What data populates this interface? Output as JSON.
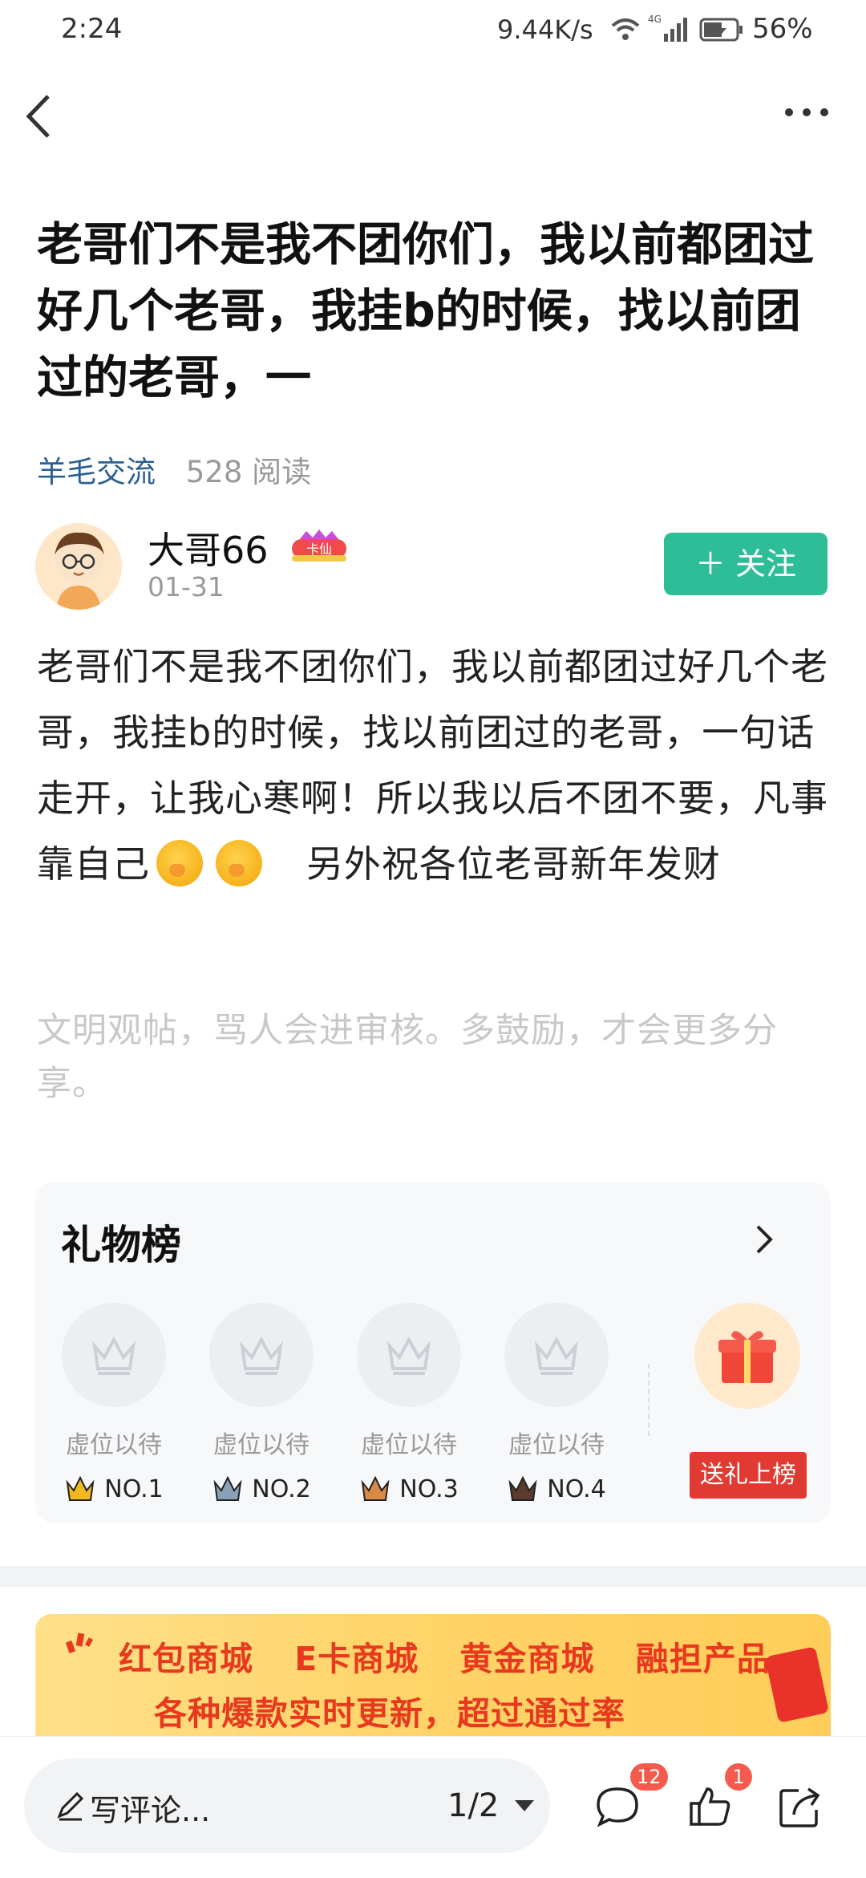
{
  "status_bar": {
    "time": "2:24",
    "net_speed": "9.44K/s",
    "battery": "56%",
    "network": "4G"
  },
  "post": {
    "title": "老哥们不是我不团你们，我以前都团过好几个老哥，我挂b的时候，找以前团过的老哥，一",
    "category": "羊毛交流",
    "reads": "528 阅读"
  },
  "author": {
    "name": "大哥66",
    "badge": "卡仙",
    "date": "01-31",
    "follow_label": "＋ 关注"
  },
  "content": {
    "part1": "老哥们不是我不团你们，我以前都团过好几个老哥，我挂b的时候，找以前团过的老哥，一句话走开，让我心寒啊！所以我以后不团不要，凡事靠自己",
    "part2": "另外祝各位老哥新年发财",
    "emoji_icon": "smirk-emoji-icon"
  },
  "notice": "文明观帖，骂人会进审核。多鼓励，才会更多分享。",
  "gift_board": {
    "title": "礼物榜",
    "slots": [
      {
        "label": "虚位以待",
        "rank": "NO.1",
        "crown_color": "#f3b921"
      },
      {
        "label": "虚位以待",
        "rank": "NO.2",
        "crown_color": "#8aa0b6"
      },
      {
        "label": "虚位以待",
        "rank": "NO.3",
        "crown_color": "#d98a45"
      },
      {
        "label": "虚位以待",
        "rank": "NO.4",
        "crown_color": "#5a3b2e"
      }
    ],
    "send_label": "送礼上榜"
  },
  "banner": {
    "row1": "红包商城 E卡商城 黄金商城 融担产品",
    "row2": "各种爆款实时更新，超过通过率"
  },
  "bottom_bar": {
    "comment_placeholder": "写评论...",
    "page_indicator": "1/2",
    "comment_count": "12",
    "like_count": "1"
  },
  "colors": {
    "accent": "#2dbd97",
    "category": "#2a5f93",
    "badge_red": "#f45b4d",
    "gift_red": "#e13a33"
  }
}
